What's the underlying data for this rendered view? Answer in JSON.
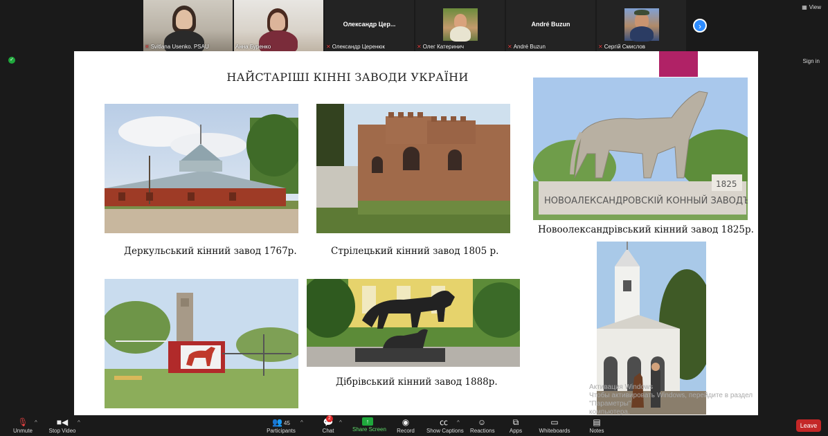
{
  "participants": [
    {
      "name": "Svitlana Usenko. PSAU",
      "muted": true,
      "video": true
    },
    {
      "name": "Анна Буренко",
      "muted": false,
      "video": true
    },
    {
      "name": "Олександр Церенюк",
      "display": "Олександр  Цер...",
      "muted": true,
      "video": false
    },
    {
      "name": "Олег Катеринич",
      "muted": true,
      "video": true
    },
    {
      "name": "André Buzun",
      "display": "André Buzun",
      "muted": true,
      "video": false
    },
    {
      "name": "Сергій Смислов",
      "muted": true,
      "video": true
    }
  ],
  "top_right": {
    "view_label": "View",
    "sign_in_label": "Sign in"
  },
  "slide": {
    "title": "НАЙСТАРІШІ КІННІ ЗАВОДИ УКРАЇНИ",
    "captions": {
      "derkul": "Деркульський кінний завод 1767р.",
      "striletskyi": "Стрілецький кінний завод 1805 р.",
      "novooleksandrivskyi": "Новоолександрівський кінний завод 1825р.",
      "dibrivskyi": "Дібрівський кінний завод 1888р."
    },
    "monument_text": "НОВОАЛЕКСАНДРОВСКІЙ  КОННЫЙ  ЗАВОДЪ",
    "monument_year": "1825"
  },
  "watermark": {
    "line1": "Активация Windows",
    "line2": "Чтобы активировать Windows, перейдите в раздел \"Параметры\"",
    "line3": "компьютера."
  },
  "toolbar": {
    "unmute": "Unmute",
    "stop_video": "Stop Video",
    "participants": "Participants",
    "participants_count": "45",
    "chat": "Chat",
    "chat_badge": "2",
    "share_screen": "Share Screen",
    "record": "Record",
    "show_captions": "Show Captions",
    "reactions": "Reactions",
    "apps": "Apps",
    "whiteboards": "Whiteboards",
    "notes": "Notes",
    "leave": "Leave"
  }
}
